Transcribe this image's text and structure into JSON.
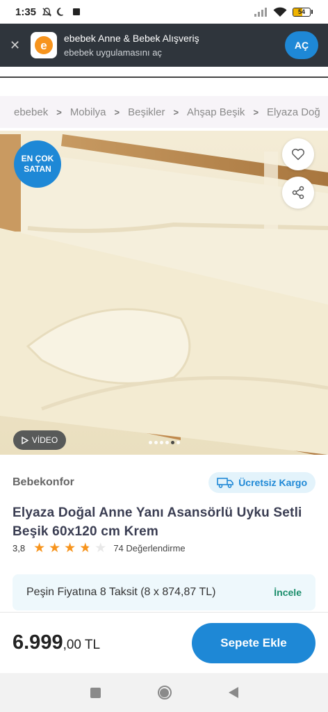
{
  "status_bar": {
    "time": "1:35",
    "battery": "54",
    "battery_level": 0.54
  },
  "app_banner": {
    "title": "ebebek Anne & Bebek Alışveriş",
    "subtitle": "ebebek uygulamasını aç",
    "open_label": "AÇ"
  },
  "breadcrumb": {
    "items": [
      "ebebek",
      "Mobilya",
      "Beşikler",
      "Ahşap Beşik",
      "Elyaza Doğ"
    ]
  },
  "gallery": {
    "badge_line1": "EN ÇOK",
    "badge_line2": "SATAN",
    "video_label": "VİDEO",
    "slide_count": 6,
    "active_slide": 5
  },
  "product": {
    "brand": "Bebekonfor",
    "shipping_label": "Ücretsiz Kargo",
    "title": "Elyaza Doğal Anne Yanı Asansörlü Uyku Setli Beşik 60x120 cm Krem",
    "rating": "3,8",
    "rating_value": 3.8,
    "review_count": "74 Değerlendirme"
  },
  "installment": {
    "text": "Peşin Fiyatına 8 Taksit (8 x 874,87 TL)",
    "link_label": "İncele"
  },
  "purchase": {
    "price_main": "6.999",
    "price_fraction": ",00 TL",
    "add_to_cart_label": "Sepete Ekle"
  },
  "colors": {
    "accent": "#1e88d6",
    "star": "#f7941d",
    "installment_link": "#1a8d6b"
  }
}
